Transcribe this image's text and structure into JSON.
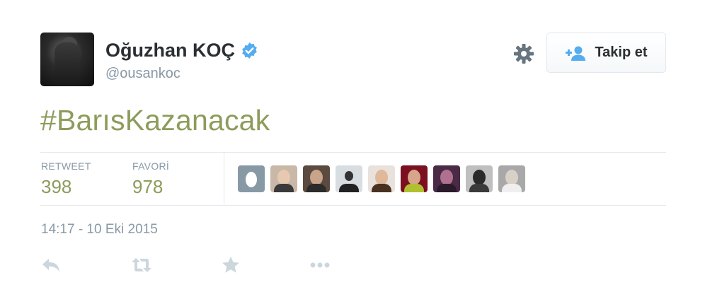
{
  "user": {
    "name": "Oğuzhan KOÇ",
    "handle": "@ousankoc",
    "verified_icon": "verified-badge-icon"
  },
  "header": {
    "follow_label": "Takip et",
    "settings_icon": "gear-icon",
    "follow_icon": "add-user-icon"
  },
  "tweet": {
    "text": "#BarısKazanacak",
    "timestamp": "14:17 - 10 Eki 2015"
  },
  "stats": {
    "retweet_label": "RETWEET",
    "retweet_count": "398",
    "favorite_label": "FAVORİ",
    "favorite_count": "978"
  },
  "favoriters": [
    "default-egg-avatar",
    "favoriter-avatar",
    "favoriter-avatar",
    "favoriter-avatar",
    "favoriter-avatar",
    "favoriter-avatar",
    "favoriter-avatar",
    "favoriter-avatar",
    "favoriter-avatar"
  ],
  "actions": [
    "reply-icon",
    "retweet-icon",
    "favorite-star-icon",
    "more-icon"
  ],
  "colors": {
    "hashtag": "#8c9c5b",
    "muted": "#8899a6",
    "verified": "#55acee",
    "text": "#292f33",
    "border": "#e1e8ed"
  }
}
